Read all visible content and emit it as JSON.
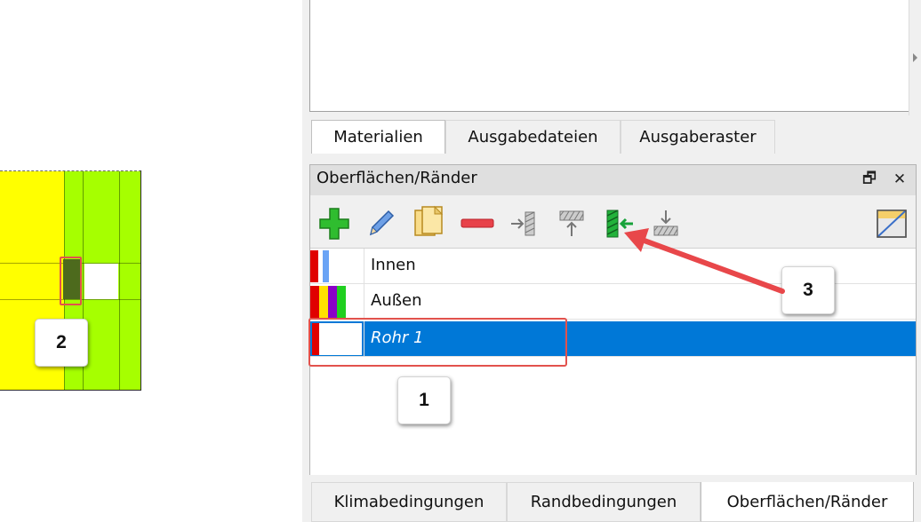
{
  "callouts": {
    "one": "1",
    "two": "2",
    "three": "3"
  },
  "top_tabs": [
    {
      "label": "Materialien",
      "active": true
    },
    {
      "label": "Ausgabedateien",
      "active": false
    },
    {
      "label": "Ausgaberaster",
      "active": false
    }
  ],
  "dock": {
    "title": "Oberflächen/Ränder",
    "float_icon": "restore-icon",
    "close_icon": "close-icon"
  },
  "toolbar": {
    "buttons": [
      {
        "name": "add-button",
        "icon": "plus-icon"
      },
      {
        "name": "edit-button",
        "icon": "pencil-icon"
      },
      {
        "name": "copy-button",
        "icon": "copy-icon"
      },
      {
        "name": "remove-button",
        "icon": "minus-icon"
      },
      {
        "name": "assign-right-button",
        "icon": "arrow-right-hatch-icon"
      },
      {
        "name": "assign-top-button",
        "icon": "arrow-up-hatch-icon"
      },
      {
        "name": "assign-selected-button",
        "icon": "green-hatch-arrow-left-icon"
      },
      {
        "name": "assign-bottom-button",
        "icon": "arrow-down-hatch-icon"
      },
      {
        "name": "surface-view-button",
        "icon": "diagonal-box-icon"
      }
    ]
  },
  "list": [
    {
      "label": "Innen",
      "colors": [
        "#e00000",
        "#ffffff",
        "#6aa4f5"
      ],
      "selected": false
    },
    {
      "label": "Außen",
      "colors": [
        "#e00000",
        "#ffe000",
        "#8a00c8",
        "#20d020"
      ],
      "selected": false
    },
    {
      "label": "Rohr 1",
      "colors": [
        "#e00000"
      ],
      "selected": true
    }
  ],
  "bottom_tabs": [
    {
      "label": "Klimabedingungen",
      "active": false
    },
    {
      "label": "Randbedingungen",
      "active": false
    },
    {
      "label": "Oberflächen/Ränder",
      "active": true
    }
  ],
  "colors": {
    "selection": "#0078d7",
    "callout_outline": "#e2524d",
    "arrow": "#e8474a"
  }
}
